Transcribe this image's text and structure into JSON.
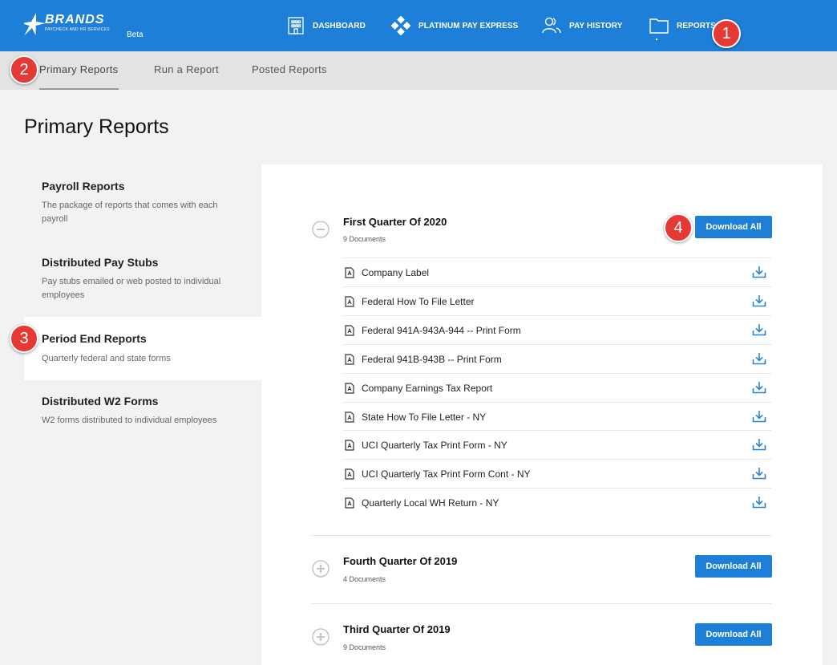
{
  "app": {
    "logo_text": "BRANDS",
    "logo_subtext": "PAYCHECK AND HR SERVICES",
    "beta_label": "Beta"
  },
  "nav": {
    "items": [
      {
        "label": "DASHBOARD",
        "icon": "building-icon"
      },
      {
        "label": "PLATINUM PAY EXPRESS",
        "icon": "diamond-cluster-icon"
      },
      {
        "label": "PAY HISTORY",
        "icon": "users-icon"
      },
      {
        "label": "REPORTS",
        "icon": "folder-icon"
      }
    ]
  },
  "subtabs": [
    {
      "label": "Primary Reports",
      "active": true
    },
    {
      "label": "Run a Report",
      "active": false
    },
    {
      "label": "Posted Reports",
      "active": false
    }
  ],
  "page_title": "Primary Reports",
  "sidebar": {
    "items": [
      {
        "title": "Payroll Reports",
        "desc": "The package of reports that comes with each payroll"
      },
      {
        "title": "Distributed Pay Stubs",
        "desc": "Pay stubs emailed or web posted to individual employees"
      },
      {
        "title": "Period End Reports",
        "desc": "Quarterly federal and state forms",
        "active": true
      },
      {
        "title": "Distributed W2 Forms",
        "desc": "W2 forms distributed to individual employees"
      }
    ]
  },
  "quarters": [
    {
      "title": "First Quarter Of 2020",
      "count": "9 Documents",
      "expanded": true,
      "button": "Download All",
      "documents": [
        "Company Label",
        "Federal How To File Letter",
        "Federal 941A-943A-944 -- Print Form",
        "Federal 941B-943B -- Print Form",
        "Company Earnings Tax Report",
        "State How To File Letter - NY",
        "UCI Quarterly Tax Print Form - NY",
        "UCI Quarterly Tax Print Form Cont - NY",
        "Quarterly Local WH Return - NY"
      ]
    },
    {
      "title": "Fourth Quarter Of 2019",
      "count": "4 Documents",
      "expanded": false,
      "button": "Download All"
    },
    {
      "title": "Third Quarter Of 2019",
      "count": "9 Documents",
      "expanded": false,
      "button": "Download All"
    }
  ],
  "markers": [
    "1",
    "2",
    "3",
    "4"
  ],
  "colors": {
    "brand": "#1e7fd8",
    "marker": "#e53935",
    "icon_blue": "#2a84d2"
  }
}
